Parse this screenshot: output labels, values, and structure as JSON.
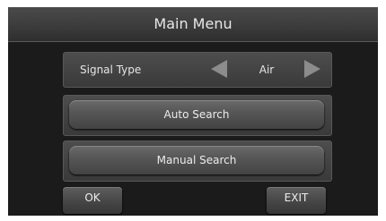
{
  "header": {
    "title": "Main Menu"
  },
  "menu": {
    "signal_type": {
      "label": "Signal Type",
      "value": "Air",
      "prev_icon": "triangle-left-icon",
      "next_icon": "triangle-right-icon"
    },
    "auto_search_label": "Auto Search",
    "manual_search_label": "Manual Search"
  },
  "footer": {
    "ok_label": "OK",
    "exit_label": "EXIT"
  }
}
